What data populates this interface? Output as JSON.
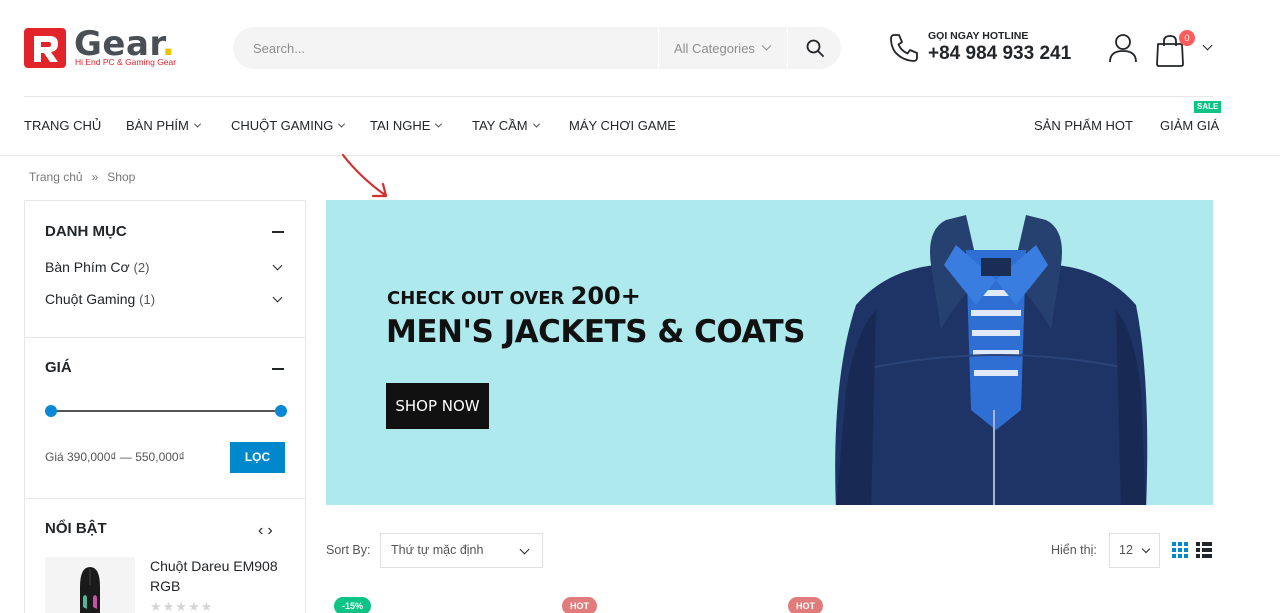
{
  "header": {
    "logo_text": "Gear",
    "logo_dot": ".",
    "logo_tagline": "Hi End PC & Gaming Gear",
    "search_placeholder": "Search...",
    "search_category": "All Categories",
    "hotline_label": "GỌI NGAY HOTLINE",
    "hotline_number": "+84 984 933 241",
    "cart_count": "0"
  },
  "nav": {
    "items": [
      {
        "label": "TRANG CHỦ"
      },
      {
        "label": "BÀN PHÍM"
      },
      {
        "label": "CHUỘT GAMING"
      },
      {
        "label": "TAI NGHE"
      },
      {
        "label": "TAY CẦM"
      },
      {
        "label": "MÁY CHƠI GAME"
      },
      {
        "label": "SẢN PHẨM HOT"
      },
      {
        "label": "GIẢM GIÁ"
      }
    ],
    "sale_badge": "SALE"
  },
  "breadcrumb": {
    "home": "Trang chủ",
    "separator": "»",
    "current": "Shop"
  },
  "sidebar": {
    "category_title": "DANH MỤC",
    "categories": [
      {
        "name": "Bàn Phím Cơ",
        "count": "(2)"
      },
      {
        "name": "Chuột Gaming",
        "count": "(1)"
      }
    ],
    "price_title": "GIÁ",
    "price_range_text": "Giá 390,000₫ — 550,000₫",
    "filter_button": "LỌC",
    "featured_title": "NỔI BẬT",
    "featured_nav": "‹›",
    "featured_product": {
      "name": "Chuột Dareu EM908 RGB",
      "stars": "★★★★★",
      "rating": 0
    }
  },
  "banner": {
    "subtitle_prefix": "CHECK OUT OVER ",
    "subtitle_number": "200+",
    "title": "MEN'S JACKETS & COATS",
    "button": "SHOP NOW"
  },
  "toolbar": {
    "sort_label": "Sort By:",
    "sort_value": "Thứ tự mặc định",
    "show_label": "Hiển thị:",
    "show_value": "12"
  },
  "product_labels": [
    "-15%",
    "HOT",
    "HOT"
  ],
  "colors": {
    "accent": "#0088cc",
    "sale_green": "#0cc485",
    "hot_red": "#e27c7c",
    "cart_badge": "#ff5b5b",
    "banner_bg": "#aee9ee",
    "logo_red": "#e2232a"
  }
}
